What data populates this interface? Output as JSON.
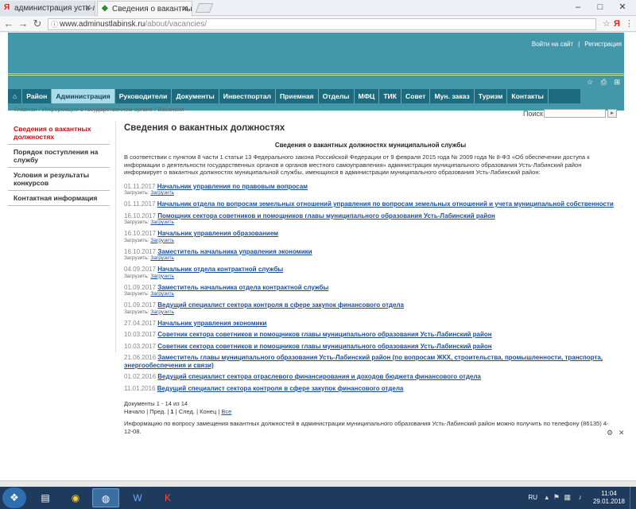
{
  "browser": {
    "tabs": [
      {
        "icon": "Я",
        "title": "администрация усть-ла"
      },
      {
        "icon": "◆",
        "title": "Сведения о вакантных д"
      }
    ],
    "url_domain": "www.adminustlabinsk.ru",
    "url_path": "/about/vacancies/",
    "window_controls": [
      "–",
      "□",
      "✕"
    ]
  },
  "site": {
    "top_links": [
      "Войти на сайт",
      "Регистрация"
    ],
    "menu": [
      "⌂",
      "Район",
      "Администрация",
      "Руководители",
      "Документы",
      "Инвестпортал",
      "Приемная",
      "Отделы",
      "МФЦ",
      "ТИК",
      "Совет",
      "Мун. заказ",
      "Туризм",
      "Контакты"
    ],
    "active_menu_index": 2,
    "breadcrumb": "Главная / Информация о государственном органе / Вакансии",
    "search_label": "Поиск",
    "search_button": "▸"
  },
  "sidebar": [
    {
      "label": "Сведения о вакантных должностях",
      "active": true
    },
    {
      "label": "Порядок поступления на службу",
      "active": false
    },
    {
      "label": "Условия и результаты конкурсов",
      "active": false
    },
    {
      "label": "Контактная информация",
      "active": false
    }
  ],
  "content": {
    "title": "Сведения о вакантных должностях",
    "subtitle": "Сведения о вакантных должностях муниципальной службы",
    "intro": "В соответствии с пунктом 8 части 1 статьи 13 Федерального закона Российской Федерации от 9 февраля 2015 года № 2009 года № 8-ФЗ «Об обеспечении доступа к информации о деятельности государственных органов и органов местного самоуправления» администрация муниципального образования Усть-Лабинский район информирует о вакантных должностях муниципальной службы, имеющихся в администрации муниципального образования Усть-Лабинский район:",
    "download_label": "Загрузить:",
    "download_link": "Загрузить",
    "vacancies": [
      {
        "date": "01.11.2017",
        "title": "Начальник управления по правовым вопросам",
        "has_download": true
      },
      {
        "date": "01.11.2017",
        "title": "Начальник отдела по вопросам земельных отношений управления по вопросам земельных отношений и учета муниципальной собственности",
        "has_download": false
      },
      {
        "date": "16.10.2017",
        "title": "Помощник сектора советников и помощников главы муниципального образования Усть-Лабинский район",
        "has_download": true
      },
      {
        "date": "16.10.2017",
        "title": "Начальник управления образованием",
        "has_download": true
      },
      {
        "date": "16.10.2017",
        "title": "Заместитель начальника управления экономики",
        "has_download": true
      },
      {
        "date": "04.09.2017",
        "title": "Начальник отдела контрактной службы",
        "has_download": true
      },
      {
        "date": "01.09.2017",
        "title": "Заместитель начальника отдела контрактной службы",
        "has_download": true
      },
      {
        "date": "01.09.2017",
        "title": "Ведущий специалист сектора контроля в сфере закупок финансового отдела",
        "has_download": true
      },
      {
        "date": "27.04.2017",
        "title": "Начальник управления экономики",
        "has_download": false
      },
      {
        "date": "10.03.2017",
        "title": "Советник сектора советников и помощников главы муниципального образования Усть-Лабинский район",
        "has_download": false
      },
      {
        "date": "10.03.2017",
        "title": "Советник сектора советников и помощников главы муниципального образования Усть-Лабинский район",
        "has_download": false
      },
      {
        "date": "21.06.2016",
        "title": "Заместитель главы муниципального образования Усть-Лабинский район (по вопросам ЖКХ, строительства, промышленности, транспорта, энергообеспечения и связи)",
        "has_download": false
      },
      {
        "date": "01.02.2016",
        "title": "Ведущий специалист сектора отраслевого финансирования и доходов бюджета финансового отдела",
        "has_download": false
      },
      {
        "date": "11.01.2016",
        "title": "Ведущий специалист сектора контроля в сфере закупок финансового отдела",
        "has_download": false
      }
    ],
    "pager_count": "Документы 1 - 14 из 14",
    "pager": {
      "start": "Начало",
      "prev": "Пред.",
      "page": "1",
      "next": "След.",
      "end": "Конец",
      "all": "Все"
    },
    "footer_note": "Информацию по вопросу замещения вакантных должностей в администрации муниципального образования Усть-Лабинский район можно получить по телефону (86135) 4-12-08."
  },
  "taskbar": {
    "lang": "RU",
    "time": "11:04",
    "date": "29.01.2018"
  }
}
